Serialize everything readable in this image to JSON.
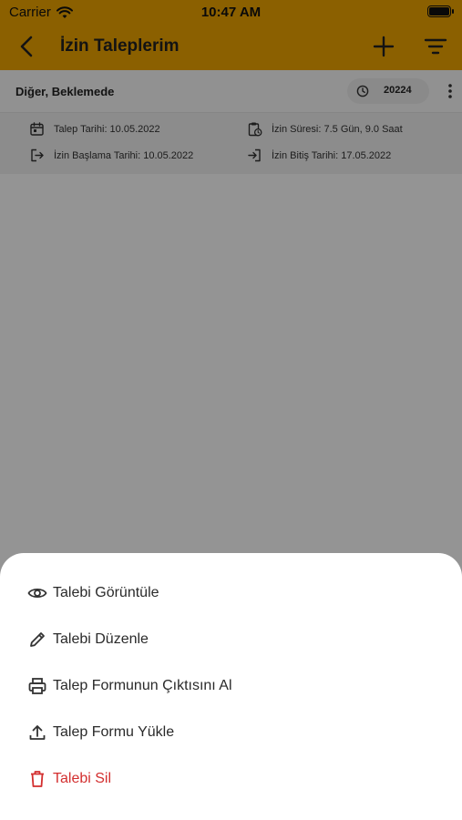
{
  "status_bar": {
    "carrier": "Carrier",
    "time": "10:47 AM"
  },
  "app_bar": {
    "title": "İzin Taleplerim",
    "icons": [
      "back-arrow-icon",
      "plus-icon",
      "filter-icon"
    ]
  },
  "request": {
    "status_label": "Diğer, Beklemede",
    "request_no": "20224",
    "request_date": "Talep Tarihi: 10.05.2022",
    "leave_duration": "İzin Süresi: 7.5 Gün, 9.0 Saat",
    "start_date": "İzin Başlama Tarihi: 10.05.2022",
    "end_date": "İzin Bitiş Tarihi: 17.05.2022"
  },
  "sheet": {
    "items": [
      {
        "label": "Talebi Görüntüle",
        "icon": "eye-icon"
      },
      {
        "label": "Talebi Düzenle",
        "icon": "pencil-icon"
      },
      {
        "label": "Talep Formunun Çıktısını Al",
        "icon": "printer-icon"
      },
      {
        "label": "Talep Formu Yükle",
        "icon": "upload-icon"
      },
      {
        "label": "Talebi Sil",
        "icon": "trash-icon"
      }
    ]
  },
  "colors": {
    "accent": "#f0a500",
    "danger": "#d32f2f"
  }
}
